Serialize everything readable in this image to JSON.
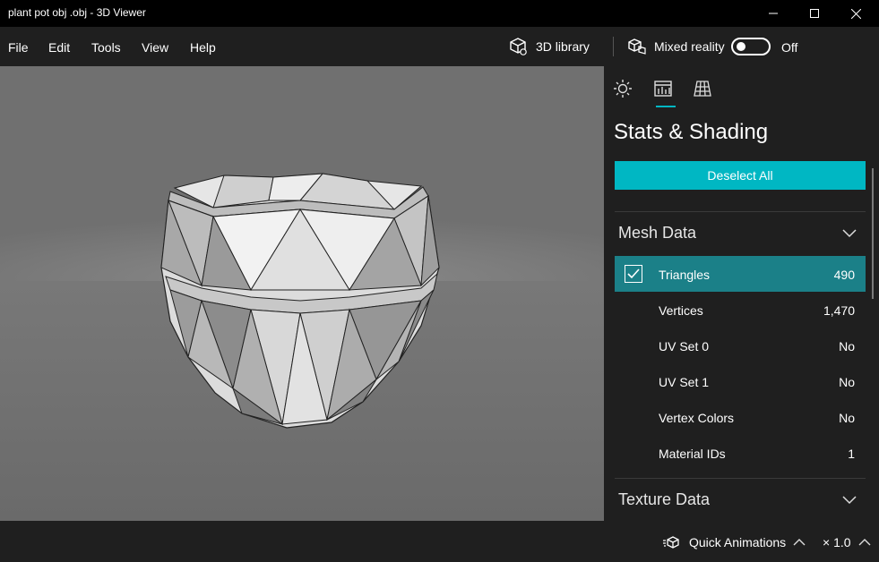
{
  "window": {
    "title": "plant pot obj .obj - 3D Viewer"
  },
  "menu": {
    "items": [
      "File",
      "Edit",
      "Tools",
      "View",
      "Help"
    ]
  },
  "toolbar": {
    "library_label": "3D library",
    "mixed_reality_label": "Mixed reality",
    "mixed_reality_state": "Off",
    "mixed_reality_on": false
  },
  "panel": {
    "tabs": [
      {
        "icon": "sun-icon",
        "active": false
      },
      {
        "icon": "stats-chart-icon",
        "active": true
      },
      {
        "icon": "grid-icon",
        "active": false
      }
    ],
    "title": "Stats & Shading",
    "deselect_label": "Deselect All",
    "mesh_section": "Mesh Data",
    "mesh_rows": [
      {
        "label": "Triangles",
        "value": "490",
        "checked": true
      },
      {
        "label": "Vertices",
        "value": "1,470",
        "checked": false
      },
      {
        "label": "UV Set 0",
        "value": "No",
        "checked": false
      },
      {
        "label": "UV Set 1",
        "value": "No",
        "checked": false
      },
      {
        "label": "Vertex Colors",
        "value": "No",
        "checked": false
      },
      {
        "label": "Material IDs",
        "value": "1",
        "checked": false
      }
    ],
    "texture_section": "Texture Data"
  },
  "bottom": {
    "quick_animations_label": "Quick Animations",
    "speed_label": "× 1.0"
  },
  "colors": {
    "accent": "#00b7c3",
    "selected_row": "#1b8088",
    "chrome": "#1f1f1f"
  }
}
